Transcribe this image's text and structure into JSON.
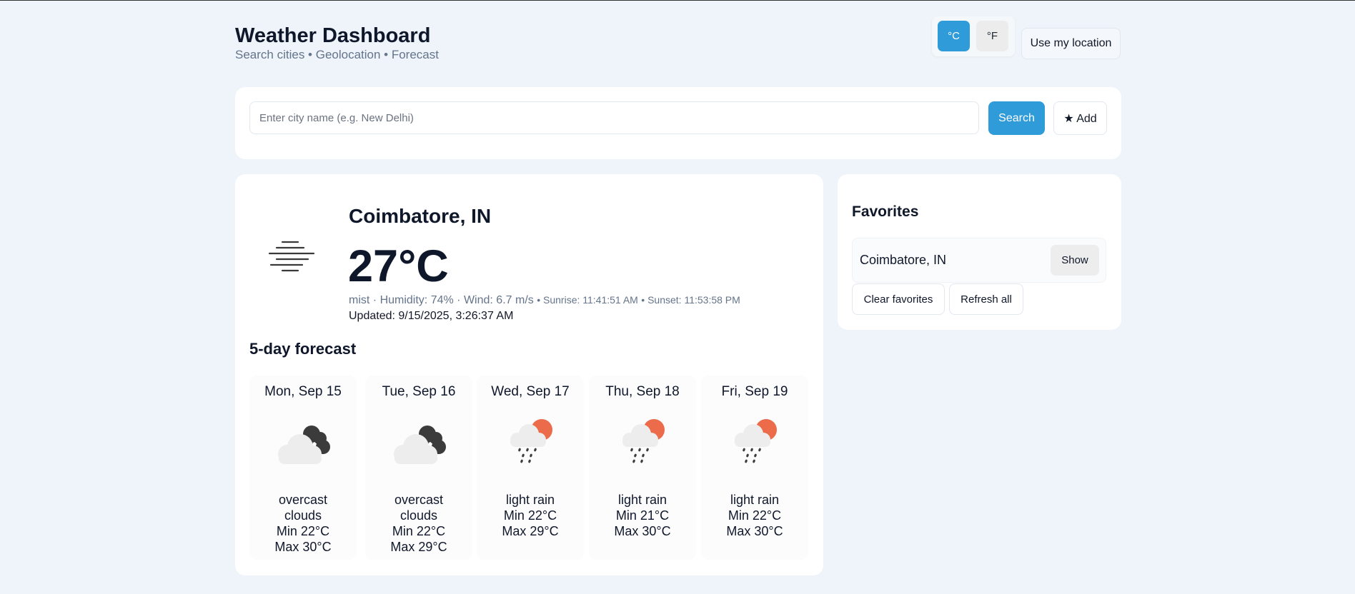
{
  "header": {
    "title": "Weather Dashboard",
    "subtitle": "Search cities • Geolocation • Forecast",
    "unit_celsius": "°C",
    "unit_fahrenheit": "°F",
    "selected_unit": "°C",
    "location_button": "Use my location"
  },
  "search": {
    "placeholder": "Enter city name (e.g. New Delhi)",
    "value": "",
    "search_button": "Search",
    "add_button": "★ Add"
  },
  "current": {
    "city": "Coimbatore, IN",
    "temperature": "27°C",
    "condition": "mist",
    "humidity": "Humidity: 74%",
    "wind": "Wind: 6.7 m/s",
    "sunrise": "Sunrise: 11:41:51 AM",
    "sunset": "Sunset: 11:53:58 PM",
    "updated": "Updated: 9/15/2025, 3:26:37 AM",
    "icon": "mist-icon"
  },
  "forecast": {
    "title": "5-day forecast",
    "days": [
      {
        "date": "Mon, Sep 15",
        "icon": "overcast-clouds-icon",
        "desc_lines": [
          "overcast",
          "clouds"
        ],
        "min": "Min 22°C",
        "max": "Max 30°C"
      },
      {
        "date": "Tue, Sep 16",
        "icon": "overcast-clouds-icon",
        "desc_lines": [
          "overcast",
          "clouds"
        ],
        "min": "Min 22°C",
        "max": "Max 29°C"
      },
      {
        "date": "Wed, Sep 17",
        "icon": "light-rain-icon",
        "desc_lines": [
          "light rain"
        ],
        "min": "Min 22°C",
        "max": "Max 29°C"
      },
      {
        "date": "Thu, Sep 18",
        "icon": "light-rain-icon",
        "desc_lines": [
          "light rain"
        ],
        "min": "Min 21°C",
        "max": "Max 30°C"
      },
      {
        "date": "Fri, Sep 19",
        "icon": "light-rain-icon",
        "desc_lines": [
          "light rain"
        ],
        "min": "Min 22°C",
        "max": "Max 30°C"
      }
    ]
  },
  "favorites": {
    "title": "Favorites",
    "items": [
      {
        "name": "Coimbatore, IN",
        "action": "Show"
      }
    ],
    "clear_button": "Clear favorites",
    "refresh_button": "Refresh all"
  },
  "colors": {
    "accent": "#2f9bd8",
    "background": "#eef4fa",
    "sun": "#ec6b4a"
  }
}
